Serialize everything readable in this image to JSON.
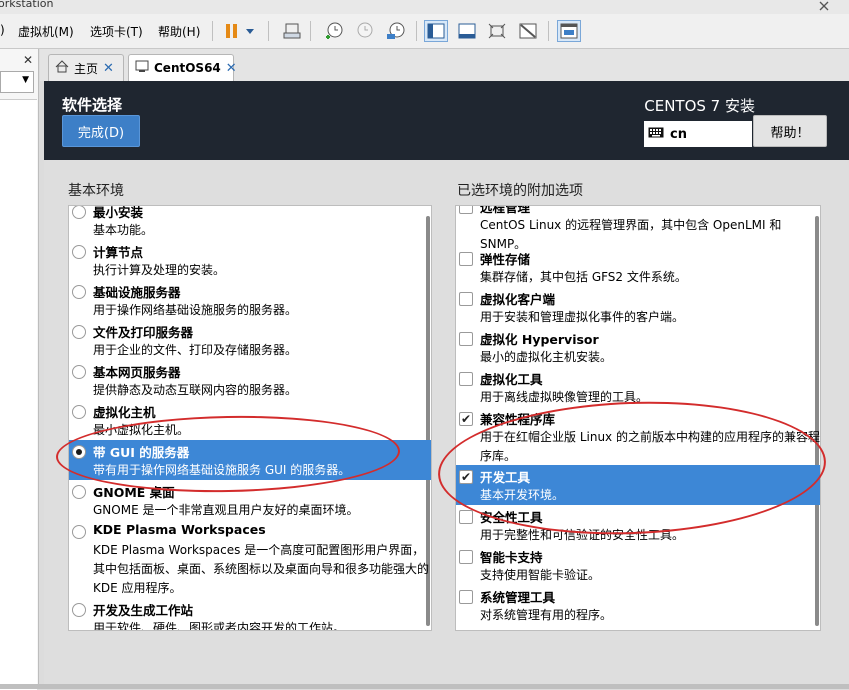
{
  "window": {
    "title_fragment": "orkstation"
  },
  "menu": {
    "items": [
      "虚拟机(M)",
      "选项卡(T)",
      "帮助(H)"
    ]
  },
  "toolbar": {
    "icons": [
      "pause-icon",
      "dropdown-icon",
      "send-keys-icon",
      "snapshot-icon",
      "revert-snapshot-icon",
      "snapshot-manager-icon",
      "console-view-icon",
      "fullscreen-icon",
      "stretch-icon",
      "unity-icon",
      "library-icon"
    ]
  },
  "sidebar": {
    "close_glyph": "✕"
  },
  "tabs": [
    {
      "label": "主页",
      "close": "✕"
    },
    {
      "label": "CentOS64",
      "close": "✕"
    }
  ],
  "installer": {
    "page_title": "软件选择",
    "done_label": "完成(D)",
    "product_title": "CENTOS 7 安装",
    "keyboard_layout": "cn",
    "help_label": "帮助！"
  },
  "base_env": {
    "heading": "基本环境",
    "items": [
      {
        "title": "最小安装",
        "desc": "基本功能。",
        "selected": false
      },
      {
        "title": "计算节点",
        "desc": "执行计算及处理的安装。",
        "selected": false
      },
      {
        "title": "基础设施服务器",
        "desc": "用于操作网络基础设施服务的服务器。",
        "selected": false
      },
      {
        "title": "文件及打印服务器",
        "desc": "用于企业的文件、打印及存储服务器。",
        "selected": false
      },
      {
        "title": "基本网页服务器",
        "desc": "提供静态及动态互联网内容的服务器。",
        "selected": false
      },
      {
        "title": "虚拟化主机",
        "desc": "最小虚拟化主机。",
        "selected": false
      },
      {
        "title": "带 GUI 的服务器",
        "desc": "带有用于操作网络基础设施服务 GUI 的服务器。",
        "selected": true
      },
      {
        "title": "GNOME 桌面",
        "desc": "GNOME 是一个非常直观且用户友好的桌面环境。",
        "selected": false
      },
      {
        "title": "KDE Plasma Workspaces",
        "desc": "KDE Plasma Workspaces 是一个高度可配置图形用户界面，其中包括面板、桌面、系统图标以及桌面向导和很多功能强大的 KDE 应用程序。",
        "selected": false
      },
      {
        "title": "开发及生成工作站",
        "desc": "用于软件、硬件、图形或者内容开发的工作站。",
        "selected": false
      }
    ]
  },
  "addons": {
    "heading": "已选环境的附加选项",
    "items": [
      {
        "title": "远程管理",
        "desc": "CentOS Linux 的远程管理界面，其中包含 OpenLMI 和 SNMP。",
        "checked": false
      },
      {
        "title": "弹性存储",
        "desc": "集群存储，其中包括 GFS2 文件系统。",
        "checked": false
      },
      {
        "title": "虚拟化客户端",
        "desc": "用于安装和管理虚拟化事件的客户端。",
        "checked": false
      },
      {
        "title": "虚拟化 Hypervisor",
        "desc": "最小的虚拟化主机安装。",
        "checked": false
      },
      {
        "title": "虚拟化工具",
        "desc": "用于离线虚拟映像管理的工具。",
        "checked": false
      },
      {
        "title": "兼容性程序库",
        "desc": "用于在红帽企业版 Linux 的之前版本中构建的应用程序的兼容程序库。",
        "checked": true
      },
      {
        "title": "开发工具",
        "desc": "基本开发环境。",
        "checked": true
      },
      {
        "title": "安全性工具",
        "desc": "用于完整性和可信验证的安全性工具。",
        "checked": false
      },
      {
        "title": "智能卡支持",
        "desc": "支持使用智能卡验证。",
        "checked": false
      },
      {
        "title": "系统管理工具",
        "desc": "对系统管理有用的程序。",
        "checked": false
      }
    ]
  },
  "colors": {
    "header_bg": "#1f2630",
    "selection": "#3d87d6",
    "annotation": "#d32c2c",
    "done_button": "#3d7fc7"
  }
}
